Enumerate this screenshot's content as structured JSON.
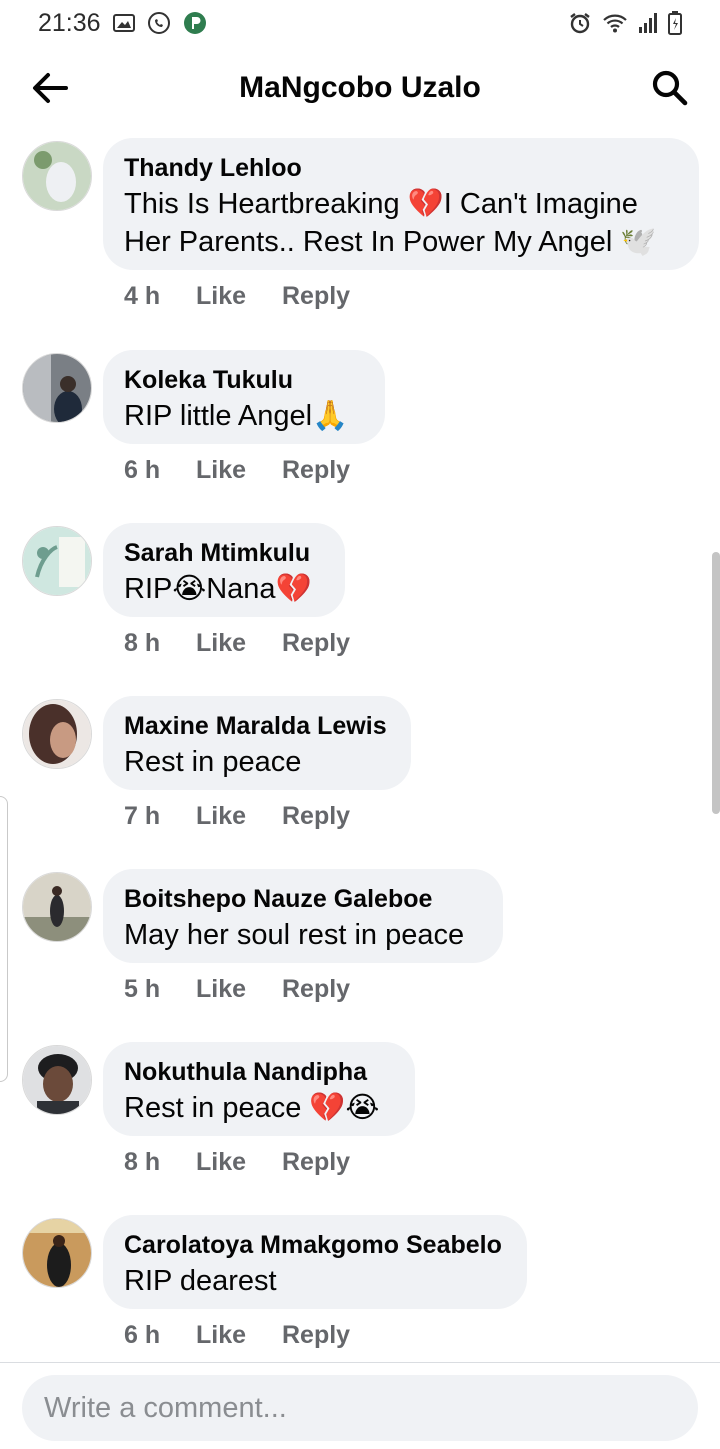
{
  "status_bar": {
    "time": "21:36",
    "left_icons": [
      "gallery-icon",
      "whatsapp-icon",
      "app-p-icon"
    ],
    "right_icons": [
      "alarm-icon",
      "wifi-icon",
      "signal-icon",
      "battery-icon"
    ]
  },
  "header": {
    "title": "MaNgcobo Uzalo",
    "back_icon": "arrow-left-icon",
    "search_icon": "search-icon"
  },
  "actions": {
    "like": "Like",
    "reply": "Reply"
  },
  "comments": [
    {
      "author": "Thandy Lehloo",
      "lines": [
        "This Is Heartbreaking 💔I Can't Imagine",
        "Her Parents.. Rest In Power My Angel 🕊️"
      ],
      "time": "4 h",
      "avatar_color": "#c9d8c4"
    },
    {
      "author": "Koleka Tukulu",
      "lines": [
        "RIP little Angel🙏"
      ],
      "time": "6 h",
      "avatar_color": "#7a7f85"
    },
    {
      "author": "Sarah Mtimkulu",
      "lines": [
        "RIP😭Nana💔"
      ],
      "time": "8 h",
      "avatar_color": "#cfe7e0"
    },
    {
      "author": "Maxine Maralda Lewis",
      "lines": [
        "Rest in peace"
      ],
      "time": "7 h",
      "avatar_color": "#6a4a3c"
    },
    {
      "author": "Boitshepo Nauze Galeboe",
      "lines": [
        "May her soul rest in peace"
      ],
      "time": "5 h",
      "avatar_color": "#8d8f7c"
    },
    {
      "author": "Nokuthula Nandipha",
      "lines": [
        "Rest in peace 💔😭"
      ],
      "time": "8 h",
      "avatar_color": "#5b5f63"
    },
    {
      "author": "Carolatoya Mmakgomo Seabelo",
      "lines": [
        "RIP dearest"
      ],
      "time": "6 h",
      "avatar_color": "#9a6b3a"
    }
  ],
  "composer": {
    "placeholder": "Write a comment..."
  }
}
